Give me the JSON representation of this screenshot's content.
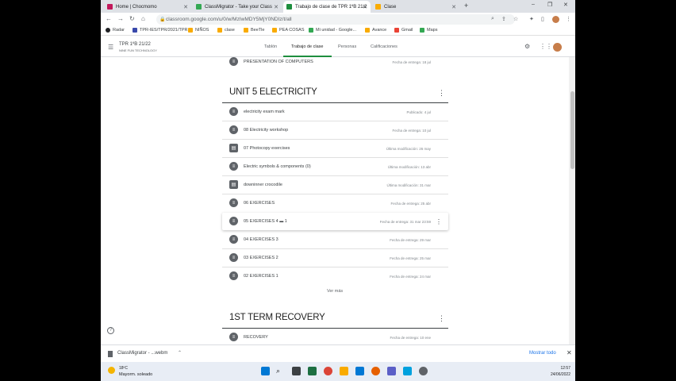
{
  "browser": {
    "tabs": [
      {
        "label": "Home | Chocmomo",
        "icon": "chocmomo-favicon"
      },
      {
        "label": "ClassMigrator - Take your Class",
        "icon": "classmigrator-favicon"
      },
      {
        "label": "Trabajo de clase de TPR 1ºB 21/2",
        "icon": "classroom-favicon"
      },
      {
        "label": "Clase",
        "icon": "classroom-favicon"
      }
    ],
    "url": "classroom.google.com/u/0/w/MzIwMDY5MjY0NDIz/t/all",
    "bookmarks": [
      "Radar",
      "TPR-IES/TPR/2021/TPR...",
      "NIÑOS",
      "clase",
      "BeeTle",
      "PEA COSAS",
      "Mi unidad - Google...",
      "Avance",
      "Gmail",
      "Maps"
    ]
  },
  "classroom": {
    "class_name": "TPR 1ºB 21/22",
    "class_sub": "NINE FUN TECHNOLOGY",
    "tabs": [
      "Tablón",
      "Trabajo de clase",
      "Personas",
      "Calificaciones"
    ],
    "top_item": {
      "title": "PRESENTATION OF COMPUTERS",
      "meta": "Fecha de entrega: 18 jul"
    },
    "topic1": {
      "title": "UNIT 5 ELECTRICITY",
      "items": [
        {
          "title": "electricity exam mark",
          "meta": "Publicado: 4 jul"
        },
        {
          "title": "08 Electricity workshop",
          "meta": "Fecha de entrega: 10 jul"
        },
        {
          "title": "07 Photocopy exercises",
          "meta": "Última modificación: 26 may"
        },
        {
          "title": "Electric symbols & components (0)",
          "meta": "Última modificación: 13 abr"
        },
        {
          "title": "downinner crocodile",
          "meta": "Última modificación: 31 mar"
        },
        {
          "title": "06 EXERCISES",
          "meta": "Fecha de entrega: 25 abr"
        },
        {
          "title": "05 EXERCISES 4",
          "meta": "Fecha de entrega: 31 mar 23:59"
        },
        {
          "title": "04 EXERCISES 3",
          "meta": "Fecha de entrega: 29 mar"
        },
        {
          "title": "03 EXERCISES 2",
          "meta": "Fecha de entrega: 25 mar"
        },
        {
          "title": "02 EXERCISES 1",
          "meta": "Fecha de entrega: 24 mar"
        }
      ],
      "hover_badge": "1",
      "see_more": "Ver más"
    },
    "topic2": {
      "title": "1ST TERM RECOVERY",
      "items": [
        {
          "title": "RECOVERY",
          "meta": "Fecha de entrega: 10 ene"
        }
      ]
    }
  },
  "downloads": {
    "file": "ClassMigrator - ...webm",
    "show_all": "Mostrar todo"
  },
  "taskbar": {
    "temp": "18ºC",
    "weather": "Mayorm. soleado",
    "time": "12:57",
    "date": "24/06/2022"
  }
}
